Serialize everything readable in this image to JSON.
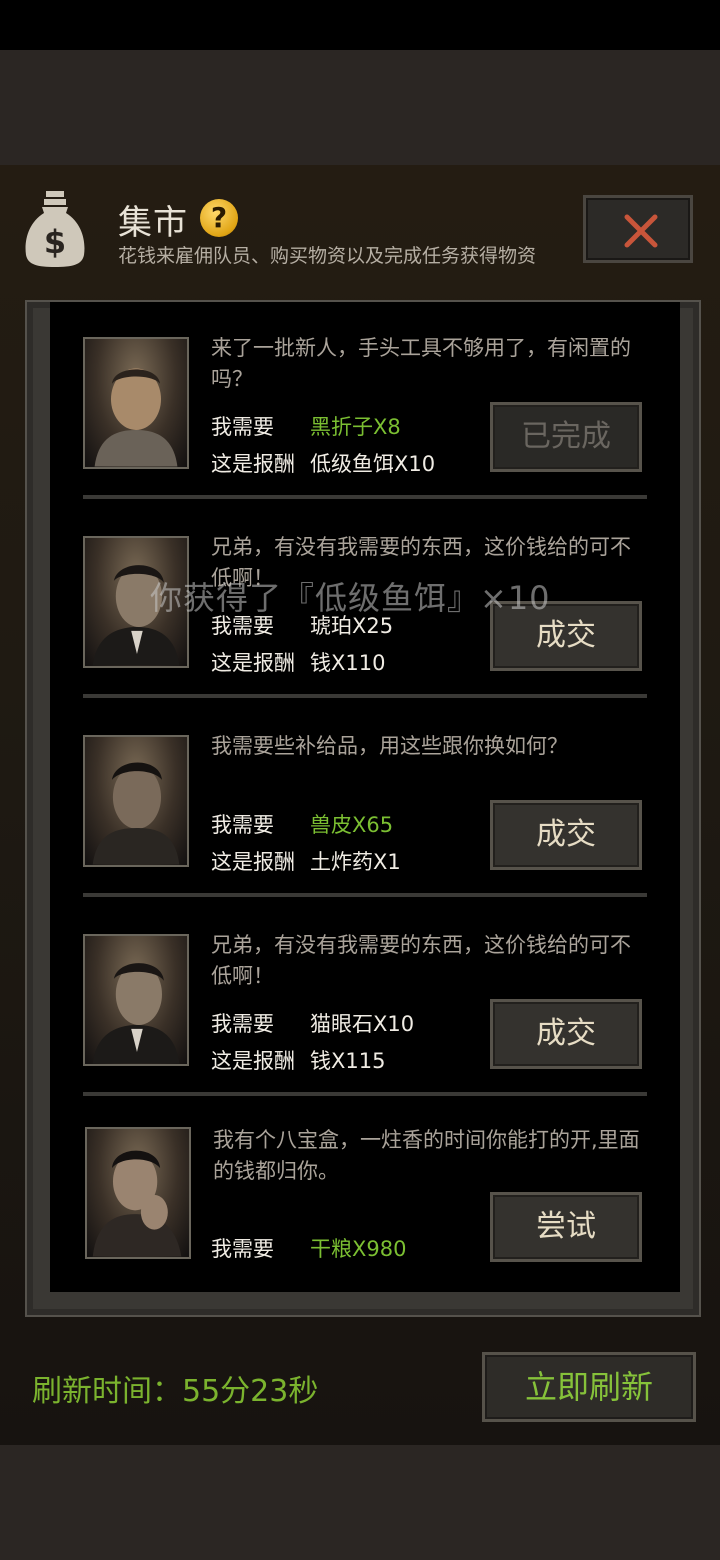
{
  "header": {
    "title": "集市",
    "subtitle": "花钱来雇佣队员、购买物资以及完成任务获得物资"
  },
  "labels": {
    "need": "我需要",
    "reward": "这是报酬"
  },
  "toast": "你获得了『低级鱼饵』×10",
  "trades": [
    {
      "message": "来了一批新人，手头工具不够用了，有闲置的吗？",
      "need": "黑折子X8",
      "reward": "低级鱼饵X10",
      "button": "已完成",
      "status": "completed"
    },
    {
      "message": "兄弟，有没有我需要的东西，这价钱给的可不低啊！",
      "need": "琥珀X25",
      "reward": "钱X110",
      "button": "成交",
      "status": "available"
    },
    {
      "message": "我需要些补给品，用这些跟你换如何？",
      "need": "兽皮X65",
      "reward": "土炸药X1",
      "button": "成交",
      "status": "available"
    },
    {
      "message": "兄弟，有没有我需要的东西，这价钱给的可不低啊！",
      "need": "猫眼石X10",
      "reward": "钱X115",
      "button": "成交",
      "status": "available"
    },
    {
      "message": "我有个八宝盒，一炷香的时间你能打的开,里面的钱都归你。",
      "need": "干粮X980",
      "button": "尝试",
      "status": "available"
    }
  ],
  "footer": {
    "refresh_time": "刷新时间：55分23秒",
    "refresh_button": "立即刷新"
  },
  "colors": {
    "highlight_green": "#7bbf32",
    "background": "#000000"
  }
}
